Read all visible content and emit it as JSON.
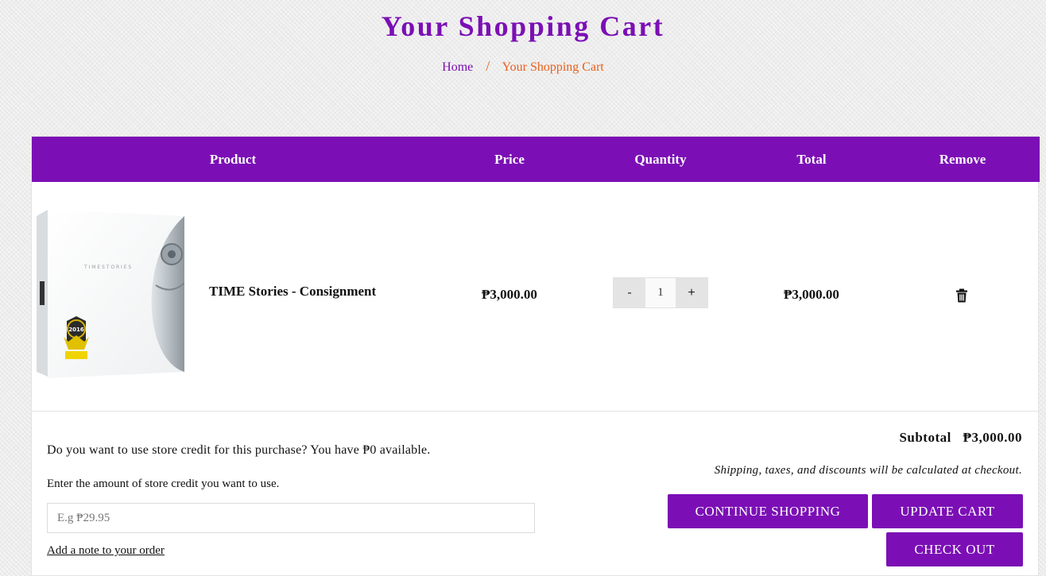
{
  "page": {
    "title": "Your Shopping Cart"
  },
  "breadcrumb": {
    "home": "Home",
    "separator": "/",
    "current": "Your Shopping Cart"
  },
  "table": {
    "headers": {
      "product": "Product",
      "price": "Price",
      "quantity": "Quantity",
      "total": "Total",
      "remove": "Remove"
    },
    "items": [
      {
        "name": "TIME Stories - Consignment",
        "price": "₱3,000.00",
        "quantity": "1",
        "total": "₱3,000.00",
        "decrement_label": "-",
        "increment_label": "+",
        "box_text": "T I M E   S T O R I E S",
        "award_year": "2016",
        "remove_icon": "trash-icon"
      }
    ]
  },
  "store_credit": {
    "question": "Do you want to use store credit for this purchase? You have ₱0 available.",
    "label": "Enter the amount of store credit you want to use.",
    "placeholder": "E.g ₱29.95",
    "value": ""
  },
  "order_note": {
    "label": "Add a note to your order"
  },
  "summary": {
    "subtotal_label": "Subtotal",
    "subtotal_value": "₱3,000.00",
    "shipping_note": "Shipping, taxes, and discounts will be calculated at checkout."
  },
  "buttons": {
    "continue_shopping": "CONTINUE SHOPPING",
    "update_cart": "UPDATE CART",
    "check_out": "CHECK OUT"
  },
  "colors": {
    "brand": "#7b0fb5",
    "accent": "#e8601c",
    "button_text": "#ffffff"
  }
}
